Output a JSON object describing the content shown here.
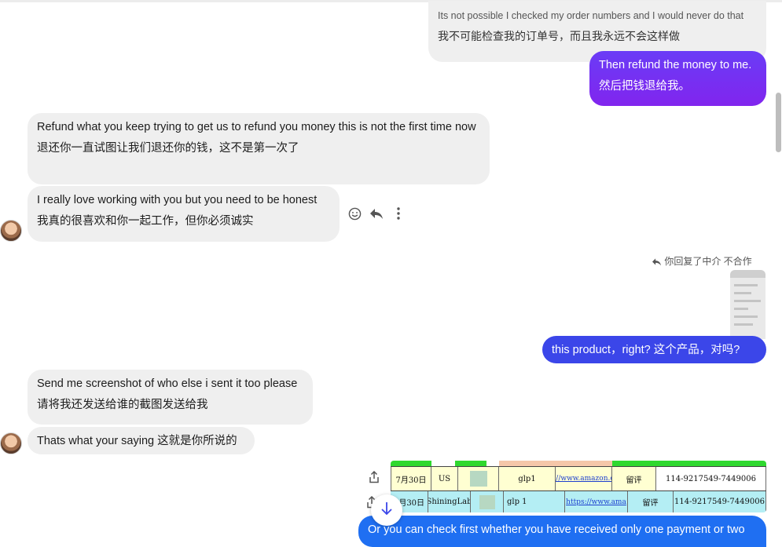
{
  "messages": [
    {
      "side": "right",
      "style": "gray",
      "en": "Its not possible I checked my order numbers and I would never do that",
      "zh": "我不可能检查我的订单号，而且我永远不会这样做"
    },
    {
      "side": "right",
      "style": "purple",
      "en": "Then refund the money to me.",
      "zh": "然后把钱退给我。"
    },
    {
      "side": "left",
      "style": "gray",
      "en": "Refund what you keep trying to get us to refund you money this is not the first time now",
      "zh": "退还你一直试图让我们退还你的钱，这不是第一次了"
    },
    {
      "side": "left",
      "style": "gray",
      "en": "I really love working with you but you need to be honest",
      "zh": "我真的很喜欢和你一起工作，但你必须诚实"
    },
    {
      "side": "right",
      "style": "blue",
      "text": "this product，right? 这个产品，对吗?"
    },
    {
      "side": "left",
      "style": "gray",
      "en": "Send me screenshot of who else i sent it too please",
      "zh": "请将我还发送给谁的截图发送给我"
    },
    {
      "side": "left",
      "style": "gray",
      "text": "Thats what your saying  这就是你所说的"
    },
    {
      "side": "right",
      "style": "blue",
      "text": "Or you can check first whether you have received only one payment or two"
    }
  ],
  "reply_indicator": "你回复了中介 不合作",
  "spreadsheet": {
    "rows": [
      [
        "7月30日",
        "US",
        "",
        "glp1",
        "https://www.amazon.com/d",
        "留评",
        "114-9217549-7449006"
      ],
      [
        "7月30日",
        "ShiningLab",
        "",
        "glp 1",
        "https://www.ama",
        "留评",
        "114-9217549-7449006"
      ]
    ]
  },
  "icons": [
    "smile-icon",
    "reply-icon",
    "more-icon",
    "share-icon",
    "reply-arrow-icon",
    "arrow-down-icon"
  ],
  "colors": {
    "purple": "#7b2ff0",
    "blue": "#3b46e9",
    "gray_bubble": "#efefef"
  }
}
